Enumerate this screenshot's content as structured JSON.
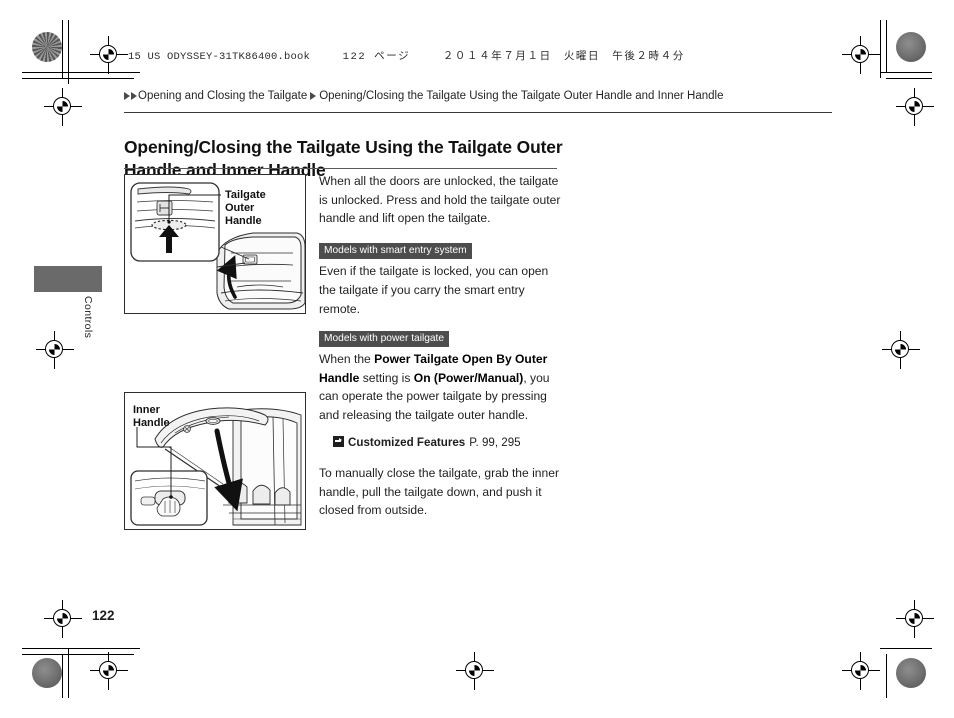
{
  "document": {
    "book_header_code": "15 US ODYSSEY-31TK86400.book",
    "book_header_page": "122 ページ",
    "book_header_date": "２０１４年７月１日　火曜日　午後２時４分",
    "folio": "122",
    "side_tab_label": "Controls"
  },
  "breadcrumb": {
    "level1": "Opening and Closing the Tailgate",
    "level2": "Opening/Closing the Tailgate Using the Tailgate Outer Handle and Inner Handle"
  },
  "page_title": "Opening/Closing the Tailgate Using the Tailgate Outer Handle and Inner Handle",
  "figures": [
    {
      "id": "outer-handle",
      "callout_line1": "Tailgate",
      "callout_line2": "Outer",
      "callout_line3": "Handle",
      "description": "Rear view of the tailgate with a magnified inset showing the tailgate outer handle and an arrow indicating to press and lift."
    },
    {
      "id": "inner-handle",
      "callout_line1": "Inner",
      "callout_line2": "Handle",
      "description": "Open tailgate seen from inside the cargo area with a magnified inset showing a hand gripping the inner handle and an arrow indicating to pull down."
    }
  ],
  "body": {
    "paragraph_1": "When all the doors are unlocked, the tailgate is unlocked. Press and hold the tailgate outer handle and lift open the tailgate.",
    "badge_smart_entry": "Models with smart entry system",
    "paragraph_2": "Even if the tailgate is locked, you can open the tailgate if you carry the smart entry remote.",
    "badge_power_tailgate": "Models with power tailgate",
    "paragraph_3": {
      "part1": "When the ",
      "bold1": "Power Tailgate Open By Outer Handle",
      "part2": " setting is ",
      "bold2": "On (Power/Manual)",
      "part3": ", you can operate the power tailgate by pressing and releasing the tailgate outer handle."
    },
    "cross_reference": {
      "icon": "jump-to-reference-icon",
      "title": "Customized Features",
      "page": "P. 99, 295"
    },
    "paragraph_4": "To manually close the tailgate, grab the inner handle, pull the tailgate down, and push it closed from outside."
  },
  "colors": {
    "badge_background": "#4d4d4d",
    "side_tab": "#6a6a6a",
    "text": "#1f1f1f",
    "rule": "#3a3a3a"
  }
}
